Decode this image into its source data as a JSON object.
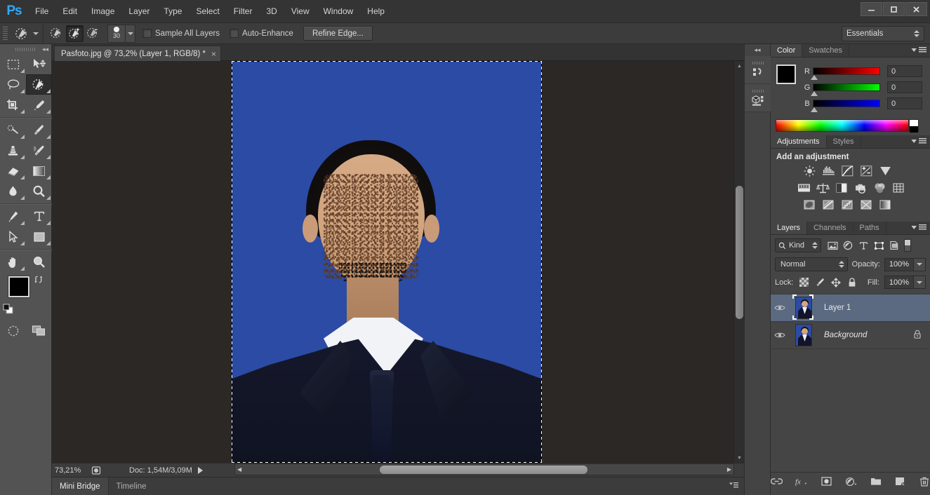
{
  "app": {
    "name": "Ps",
    "logo_color": "#31a8ff"
  },
  "menubar": {
    "items": [
      "File",
      "Edit",
      "Image",
      "Layer",
      "Type",
      "Select",
      "Filter",
      "3D",
      "View",
      "Window",
      "Help"
    ],
    "window_controls": {
      "minimize": "–",
      "maximize": "❑",
      "close": "✕"
    }
  },
  "options_bar": {
    "tool": "quick-selection-tool",
    "modes": [
      "new-selection",
      "add-to-selection",
      "subtract-from-selection"
    ],
    "active_mode": "add-to-selection",
    "brush_size": "30",
    "sample_all_layers": {
      "label": "Sample All Layers",
      "checked": false
    },
    "auto_enhance": {
      "label": "Auto-Enhance",
      "checked": false
    },
    "refine_edge_label": "Refine Edge...",
    "workspace": "Essentials"
  },
  "toolbar": {
    "tools": [
      {
        "name": "rectangular-marquee-tool",
        "active": false
      },
      {
        "name": "move-tool",
        "active": false
      },
      {
        "name": "lasso-tool",
        "active": false
      },
      {
        "name": "quick-selection-tool",
        "active": true
      },
      {
        "name": "crop-tool",
        "active": false
      },
      {
        "name": "eyedropper-tool",
        "active": false
      },
      {
        "name": "spot-healing-brush-tool",
        "active": false
      },
      {
        "name": "brush-tool",
        "active": false
      },
      {
        "name": "clone-stamp-tool",
        "active": false
      },
      {
        "name": "history-brush-tool",
        "active": false
      },
      {
        "name": "eraser-tool",
        "active": false
      },
      {
        "name": "gradient-tool",
        "active": false
      },
      {
        "name": "blur-tool",
        "active": false
      },
      {
        "name": "dodge-tool",
        "active": false
      },
      {
        "name": "pen-tool",
        "active": false
      },
      {
        "name": "horizontal-type-tool",
        "active": false
      },
      {
        "name": "path-selection-tool",
        "active": false
      },
      {
        "name": "rectangle-tool",
        "active": false
      },
      {
        "name": "hand-tool",
        "active": false
      },
      {
        "name": "zoom-tool",
        "active": false
      }
    ],
    "foreground_color": "#000000",
    "background_color": "#ffffff",
    "quick_mask": "edit-in-quick-mask-mode",
    "screen_mode": "change-screen-mode"
  },
  "document": {
    "tab_title": "Pasfoto.jpg @ 73,2% (Layer 1, RGB/8) *",
    "close_glyph": "×",
    "canvas_bg": "#2b2825",
    "image_bg_color": "#2b4ba5"
  },
  "status_bar": {
    "zoom": "73,21%",
    "doc_info": "Doc: 1,54M/3,09M"
  },
  "bottom_bar": {
    "tabs": [
      {
        "label": "Mini Bridge",
        "active": true
      },
      {
        "label": "Timeline",
        "active": false
      }
    ]
  },
  "icon_dock": {
    "items": [
      {
        "name": "history-panel-icon"
      },
      {
        "name": "3d-panel-icon"
      }
    ]
  },
  "color_panel": {
    "tabs": [
      {
        "label": "Color",
        "active": true
      },
      {
        "label": "Swatches",
        "active": false
      }
    ],
    "channels": [
      {
        "label": "R",
        "value": "0"
      },
      {
        "label": "G",
        "value": "0"
      },
      {
        "label": "B",
        "value": "0"
      }
    ],
    "foreground": "#000000",
    "background": "#ffffff"
  },
  "adjustments_panel": {
    "tabs": [
      {
        "label": "Adjustments",
        "active": true
      },
      {
        "label": "Styles",
        "active": false
      }
    ],
    "heading": "Add an adjustment",
    "row1": [
      "brightness-contrast-icon",
      "levels-icon",
      "curves-icon",
      "exposure-icon",
      "vibrance-icon"
    ],
    "row2": [
      "hue-saturation-icon",
      "color-balance-icon",
      "black-white-icon",
      "photo-filter-icon",
      "channel-mixer-icon",
      "color-lookup-icon"
    ],
    "row3": [
      "invert-icon",
      "posterize-icon",
      "threshold-icon",
      "selective-color-icon",
      "gradient-map-icon"
    ]
  },
  "layers_panel": {
    "tabs": [
      {
        "label": "Layers",
        "active": true
      },
      {
        "label": "Channels",
        "active": false
      },
      {
        "label": "Paths",
        "active": false
      }
    ],
    "filter": {
      "kind_label": "Kind",
      "icons": [
        "pixel-layer-filter-icon",
        "adjustment-layer-filter-icon",
        "type-layer-filter-icon",
        "shape-layer-filter-icon",
        "smart-object-filter-icon"
      ]
    },
    "blend_mode": "Normal",
    "opacity_label": "Opacity:",
    "opacity_value": "100%",
    "lock_label": "Lock:",
    "lock_icons": [
      "lock-transparent-pixels-icon",
      "lock-image-pixels-icon",
      "lock-position-icon",
      "lock-all-icon"
    ],
    "fill_label": "Fill:",
    "fill_value": "100%",
    "layers": [
      {
        "name": "Layer 1",
        "visible": true,
        "selected": true,
        "locked": false,
        "italic": false
      },
      {
        "name": "Background",
        "visible": true,
        "selected": false,
        "locked": true,
        "italic": true
      }
    ],
    "bottom_icons": [
      "link-layers-icon",
      "add-layer-style-icon",
      "add-layer-mask-icon",
      "new-adjustment-layer-icon",
      "new-group-icon",
      "new-layer-icon",
      "delete-layer-icon"
    ]
  }
}
